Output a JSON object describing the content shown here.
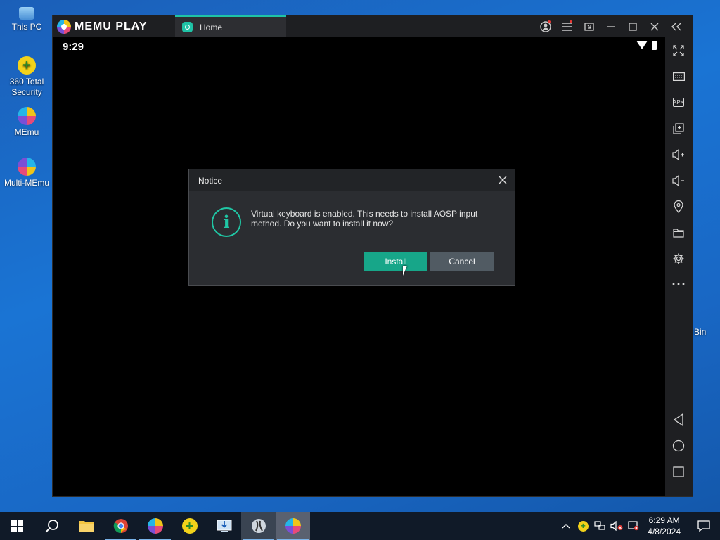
{
  "desktop": {
    "icons": [
      {
        "label": "This PC"
      },
      {
        "label": "360 Total Security"
      },
      {
        "label": "MEmu"
      },
      {
        "label": "Multi-MEmu"
      }
    ],
    "partial_label": "Bin"
  },
  "emulator": {
    "brand": "MEMU PLAY",
    "tab_label": "Home",
    "status_time": "9:29",
    "title_buttons": [
      "account-icon",
      "menu-icon",
      "multi-window-icon",
      "minimize-icon",
      "maximize-icon",
      "close-icon",
      "collapse-sidebar-icon"
    ],
    "sidebar_buttons": [
      "fullscreen-icon",
      "keyboard-icon",
      "apk-icon",
      "multi-instance-icon",
      "volume-up-icon",
      "volume-down-icon",
      "location-icon",
      "folder-icon",
      "settings-icon",
      "more-icon",
      "back-icon",
      "home-icon",
      "recents-icon"
    ],
    "apk_text": "APK"
  },
  "dialog": {
    "title": "Notice",
    "message": "Virtual keyboard is enabled. This needs to install AOSP input method. Do you want to install it now?",
    "install_label": "Install",
    "cancel_label": "Cancel",
    "accent": "#17a689"
  },
  "taskbar": {
    "time": "6:29 AM",
    "date": "4/8/2024"
  }
}
